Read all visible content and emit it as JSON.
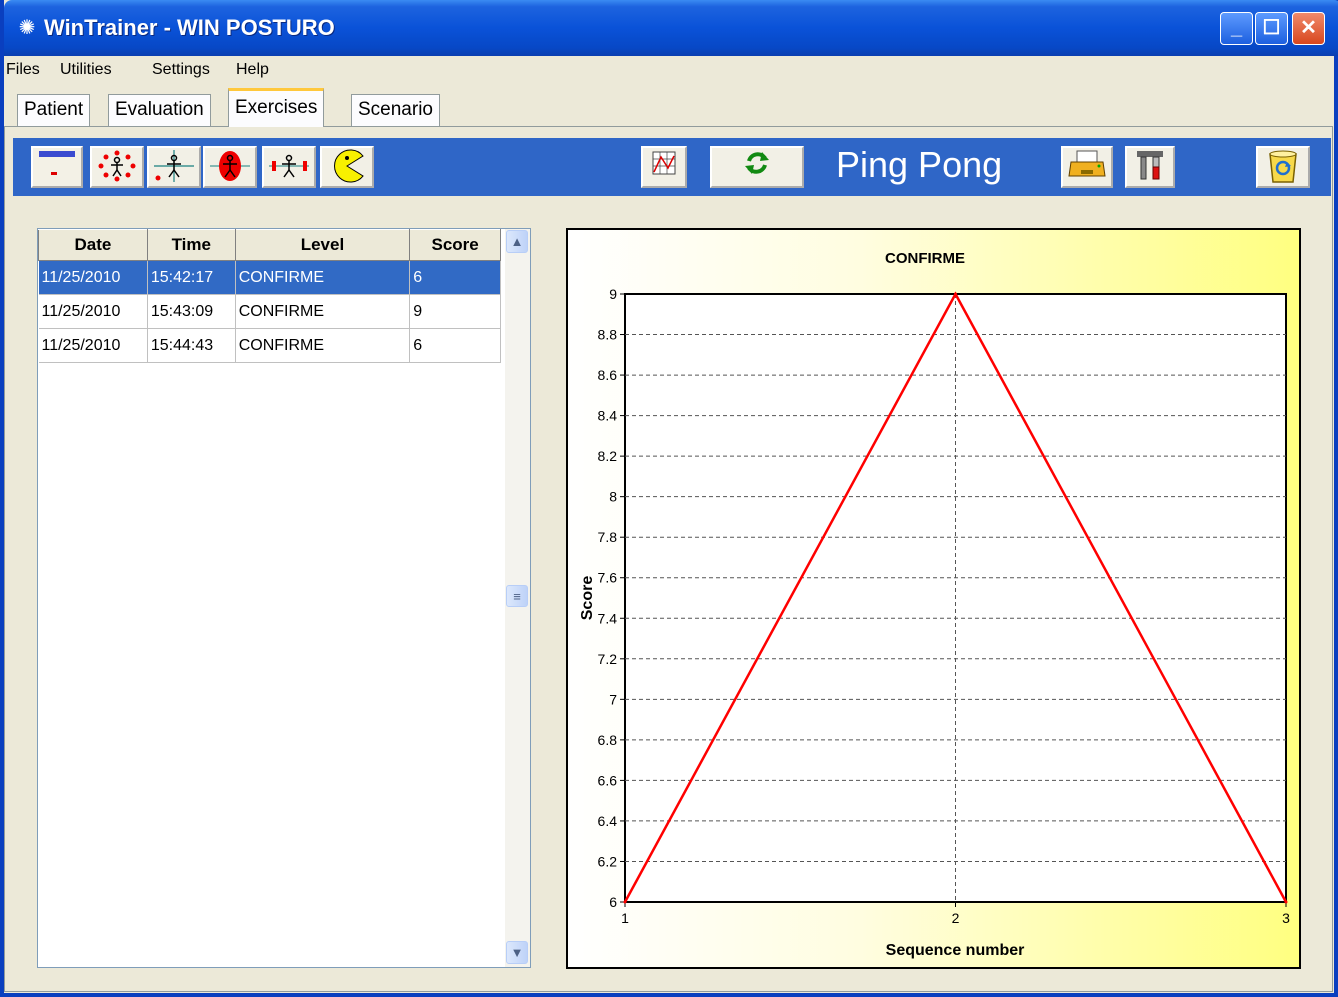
{
  "window": {
    "title": "WinTrainer - WIN POSTURO",
    "controls": [
      "minimize-icon",
      "maximize-icon",
      "close-icon"
    ]
  },
  "menu": {
    "files": "Files",
    "utilities": "Utilities",
    "settings": "Settings",
    "help": "Help"
  },
  "tabs": {
    "patient": "Patient",
    "evaluation": "Evaluation",
    "exercises": "Exercises",
    "scenario": "Scenario",
    "active": "Exercises"
  },
  "toolbar": {
    "exercise_icons": [
      "keyboard-icon",
      "target-circle-icon",
      "crosshair-icon",
      "red-ladybug-icon",
      "balance-bars-icon",
      "pacman-icon"
    ],
    "exercise_name": "Ping Pong",
    "colors": {
      "bar": "#2f66c7",
      "title": "#ffffff"
    }
  },
  "grid": {
    "columns": [
      "Date",
      "Time",
      "Level",
      "Score"
    ],
    "rows": [
      [
        "11/25/2010",
        "15:42:17",
        "CONFIRME",
        "6"
      ],
      [
        "11/25/2010",
        "15:43:09",
        "CONFIRME",
        "9"
      ],
      [
        "11/25/2010",
        "15:44:43",
        "CONFIRME",
        "6"
      ]
    ],
    "selected_row": 0
  },
  "chart_data": {
    "type": "line",
    "title": "CONFIRME",
    "xlabel": "Sequence number",
    "ylabel": "Score",
    "x": [
      1,
      2,
      3
    ],
    "series": [
      {
        "values": [
          6,
          9,
          6
        ],
        "color": "#ff0000"
      }
    ],
    "xlim": [
      1,
      3
    ],
    "ylim": [
      6,
      9
    ],
    "yticks": [
      "6",
      "6.2",
      "6.4",
      "6.6",
      "6.8",
      "7",
      "7.2",
      "7.4",
      "7.6",
      "7.8",
      "8",
      "8.2",
      "8.4",
      "8.6",
      "8.8",
      "9"
    ],
    "xticks": [
      "1",
      "2",
      "3"
    ],
    "grid": true
  }
}
